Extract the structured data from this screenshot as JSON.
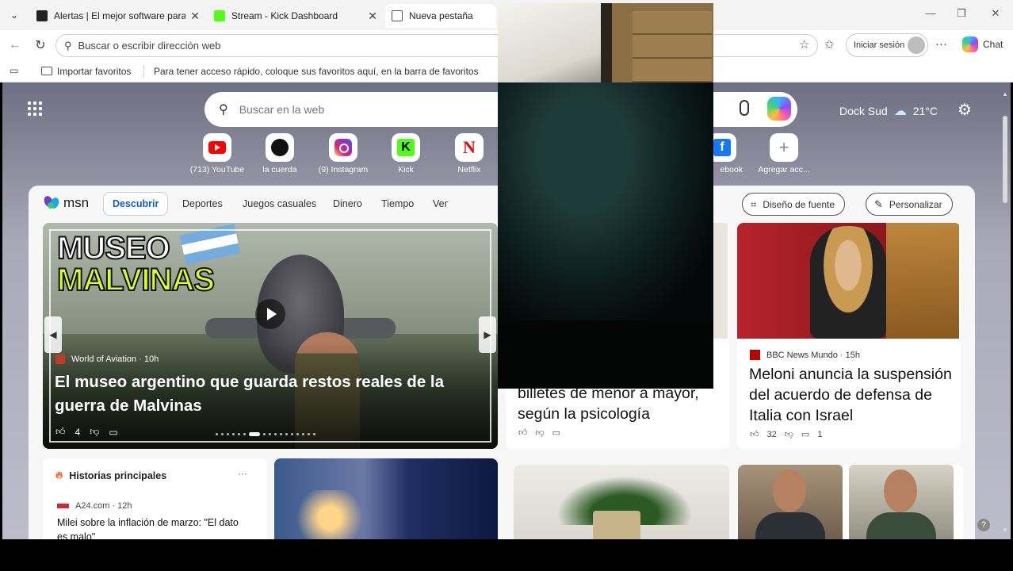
{
  "browser": {
    "tabs": [
      {
        "title": "Alertas | El mejor software para po",
        "active": false
      },
      {
        "title": "Stream - Kick Dashboard",
        "active": false
      },
      {
        "title": "Nueva pestaña",
        "active": true
      }
    ],
    "address_placeholder": "Buscar o escribir dirección web",
    "signin_label": "Iniciar sesión",
    "chat_label": "Chat",
    "favorites": {
      "import_label": "Importar favoritos",
      "hint": "Para tener acceso rápido, coloque sus favoritos aquí, en la barra de favoritos"
    }
  },
  "ntp": {
    "search_placeholder": "Buscar en la web",
    "weather": {
      "location": "Dock Sud",
      "temp": "21°C"
    },
    "shortcuts": [
      {
        "label": "(713) YouTube",
        "icon": "youtube-icon"
      },
      {
        "label": "la cuerda",
        "icon": "la-cuerda-icon"
      },
      {
        "label": "(9) Instagram",
        "icon": "instagram-icon"
      },
      {
        "label": "Kick",
        "icon": "kick-icon"
      },
      {
        "label": "Netflix",
        "icon": "netflix-icon"
      },
      {
        "label": "ebook",
        "icon": "facebook-icon"
      },
      {
        "label": "Agregar acc...",
        "icon": "plus-icon"
      }
    ]
  },
  "feed": {
    "logo": "msn",
    "nav": [
      "Descubrir",
      "Deportes",
      "Juegos casuales",
      "Dinero",
      "Tiempo",
      "Ver"
    ],
    "font_button": "Diseño de fuente",
    "personalize_button": "Personalizar",
    "hero": {
      "overlay_line1": "MUSEO",
      "overlay_line2": "MALVINAS",
      "source": "World of Aviation · 10h",
      "headline": "El museo argentino que guarda restos reales de la guerra de Malvinas",
      "likes": "4"
    },
    "mid_card": {
      "headline_visible": "billetes de menor a mayor, según la psicología"
    },
    "meloni_card": {
      "source": "BBC News Mundo · 15h",
      "headline": "Meloni anuncia la suspensión del acuerdo de defensa de Italia con Israel",
      "likes": "32",
      "comments": "1"
    },
    "top_stories": {
      "title": "Historias principales",
      "more": "···",
      "source": "A24.com · 12h",
      "headline": "Milei sobre la inflación de marzo: \"El dato es malo\""
    }
  },
  "colors": {
    "accent": "#0f5bd0",
    "kick_green": "#53fc18",
    "youtube_red": "#ff0000"
  }
}
